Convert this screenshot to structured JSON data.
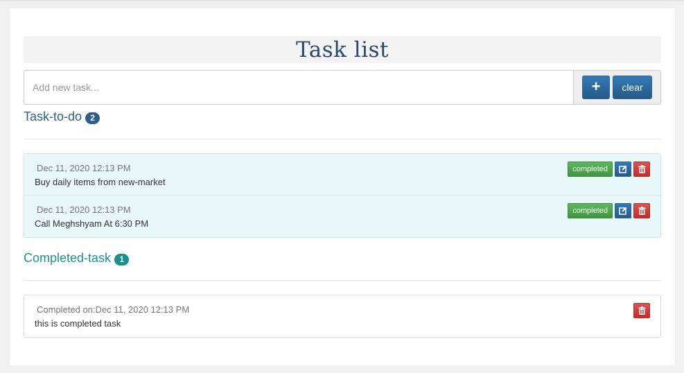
{
  "page": {
    "title": "Task list"
  },
  "input": {
    "placeholder": "Add new task...",
    "value": ""
  },
  "buttons": {
    "add_icon": "plus-icon",
    "add_symbol": "+",
    "clear_label": "clear"
  },
  "todo": {
    "heading": "Task-to-do",
    "count": "2",
    "items": [
      {
        "date": "Dec 11, 2020 12:13 PM",
        "text": "Buy daily items from new-market",
        "complete_label": "completed"
      },
      {
        "date": "Dec 11, 2020 12:13 PM",
        "text": "Call Meghshyam At 6:30 PM",
        "complete_label": "completed"
      }
    ]
  },
  "completed": {
    "heading": "Completed-task",
    "count": "1",
    "items": [
      {
        "date": "Completed on:Dec 11, 2020 12:13 PM",
        "text": "this is completed task"
      }
    ]
  },
  "icons": {
    "edit": "edit-icon",
    "delete": "trash-icon"
  },
  "colors": {
    "primary": "#2d6ca2",
    "success": "#48a34a",
    "danger": "#cc3a36",
    "todo_heading": "#2d5e8e",
    "completed_heading": "#1a9592",
    "todo_item_bg": "#e9f8f8"
  }
}
